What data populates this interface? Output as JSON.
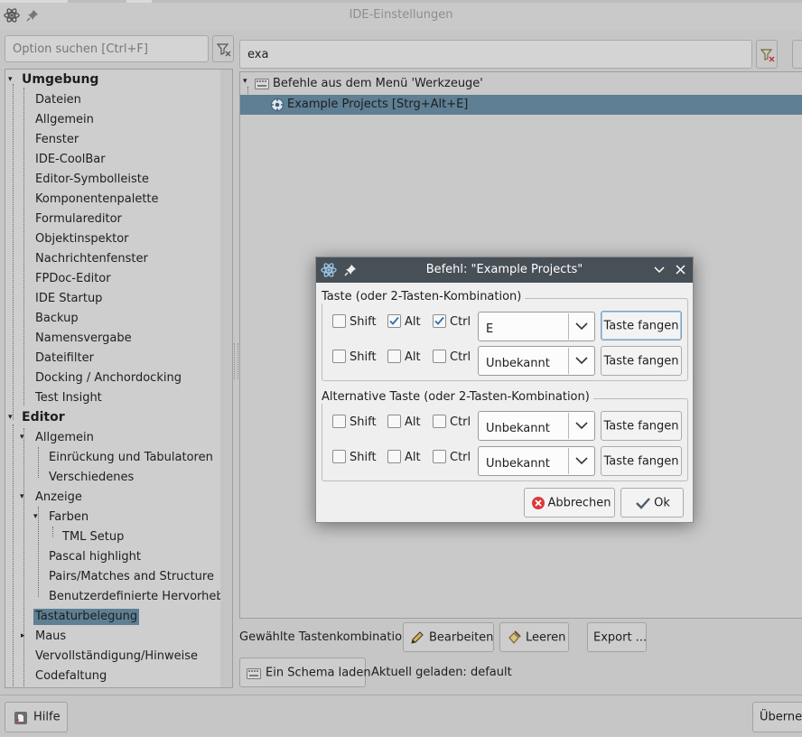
{
  "window": {
    "title": "IDE-Einstellungen"
  },
  "search": {
    "placeholder": "Option suchen [Ctrl+F]",
    "filter_value": "exa"
  },
  "tree": {
    "items": [
      {
        "label": "Umgebung",
        "bold": true
      },
      {
        "label": "Dateien"
      },
      {
        "label": "Allgemein"
      },
      {
        "label": "Fenster"
      },
      {
        "label": "IDE-CoolBar"
      },
      {
        "label": "Editor-Symbolleiste"
      },
      {
        "label": "Komponentenpalette"
      },
      {
        "label": "Formulareditor"
      },
      {
        "label": "Objektinspektor"
      },
      {
        "label": "Nachrichtenfenster"
      },
      {
        "label": "FPDoc-Editor"
      },
      {
        "label": "IDE Startup"
      },
      {
        "label": "Backup"
      },
      {
        "label": "Namensvergabe"
      },
      {
        "label": "Dateifilter"
      },
      {
        "label": "Docking / Anchordocking"
      },
      {
        "label": "Test Insight"
      },
      {
        "label": "Editor",
        "bold": true
      },
      {
        "label": "Allgemein"
      },
      {
        "label": "Einrückung und Tabulatoren"
      },
      {
        "label": "Verschiedenes"
      },
      {
        "label": "Anzeige"
      },
      {
        "label": "Farben"
      },
      {
        "label": "TML Setup"
      },
      {
        "label": "Pascal highlight"
      },
      {
        "label": "Pairs/Matches and Structure"
      },
      {
        "label": "Benutzerdefinierte Hervorhebung"
      },
      {
        "label": "Tastaturbelegung",
        "selected": true
      },
      {
        "label": "Maus"
      },
      {
        "label": "Vervollständigung/Hinweise"
      },
      {
        "label": "Codefaltung"
      }
    ]
  },
  "commands": {
    "category": "Befehle aus dem Menü 'Werkzeuge'",
    "selected_command": "Example Projects  [Strg+Alt+E]"
  },
  "bottom_bar": {
    "chosen_label": "Gewählte Tastenkombination",
    "edit_button": "Bearbeiten",
    "clear_button": "Leeren",
    "export_button": "Export ...",
    "load_scheme_button": "Ein Schema laden",
    "loaded_status": "Aktuell geladen: default"
  },
  "footer": {
    "help_button": "Hilfe",
    "apply_button": "Übernehmen"
  },
  "dialog": {
    "title": "Befehl: \"Example Projects\"",
    "key_group_label": "Taste (oder 2-Tasten-Kombination)",
    "alt_group_label": "Alternative Taste (oder 2-Tasten-Kombination)",
    "modifier_labels": {
      "shift": "Shift",
      "alt": "Alt",
      "ctrl": "Ctrl"
    },
    "rows": [
      {
        "shift": false,
        "alt": true,
        "ctrl": true,
        "key": "E",
        "grab": "Taste fangen"
      },
      {
        "shift": false,
        "alt": false,
        "ctrl": false,
        "key": "Unbekannt",
        "grab": "Taste fangen"
      },
      {
        "shift": false,
        "alt": false,
        "ctrl": false,
        "key": "Unbekannt",
        "grab": "Taste fangen"
      },
      {
        "shift": false,
        "alt": false,
        "ctrl": false,
        "key": "Unbekannt",
        "grab": "Taste fangen"
      }
    ],
    "cancel_button": "Abbrechen",
    "ok_button": "Ok"
  },
  "colors": {
    "selection": "#5e7f94",
    "dialog_titlebar": "#475057",
    "cancel_icon": "#d93a3a"
  }
}
